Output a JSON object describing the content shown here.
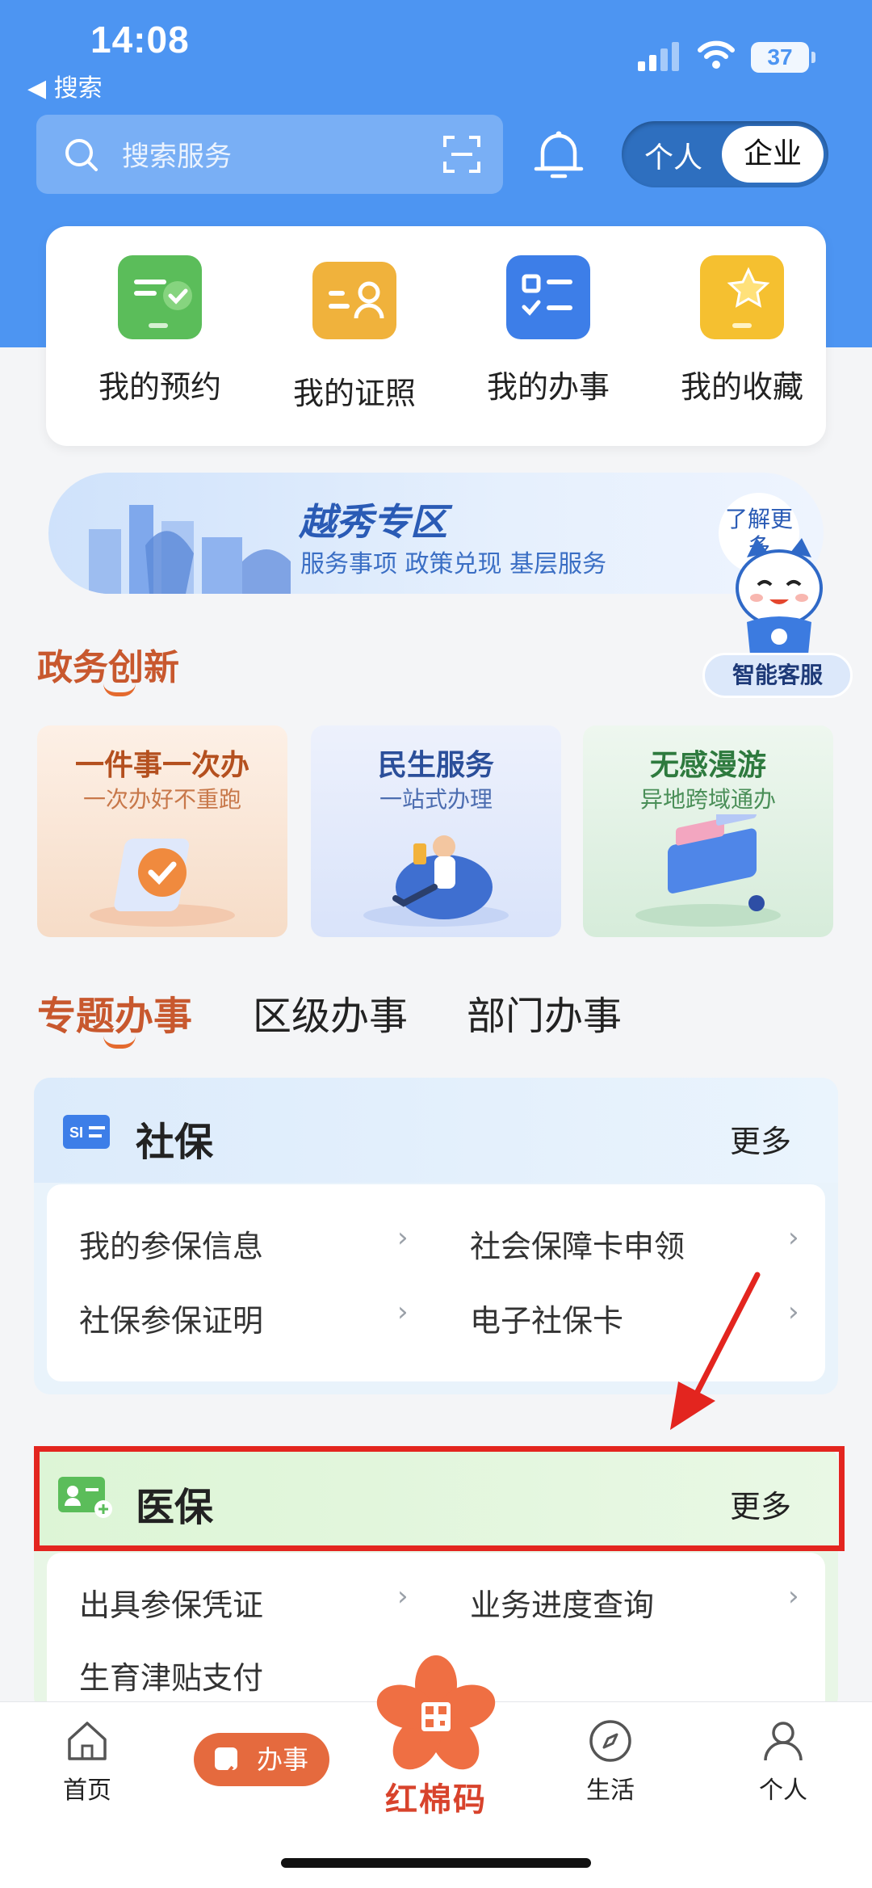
{
  "status_bar": {
    "time": "14:08",
    "back_label": "◀ 搜索",
    "battery": "37"
  },
  "header": {
    "search_placeholder": "搜索服务",
    "toggle": {
      "personal": "个人",
      "company": "企业",
      "selected": "企业"
    }
  },
  "quick_actions": [
    {
      "label": "我的预约",
      "icon": "appointment-icon",
      "color": "#5bbd5a"
    },
    {
      "label": "我的证照",
      "icon": "license-icon",
      "color": "#f0b23c"
    },
    {
      "label": "我的办事",
      "icon": "tasks-icon",
      "color": "#3d7ee8"
    },
    {
      "label": "我的收藏",
      "icon": "favorites-icon",
      "color": "#f5c030"
    }
  ],
  "banner": {
    "title": "越秀专区",
    "subtitle": "服务事项  政策兑现  基层服务",
    "more": "了解更多"
  },
  "assistant": {
    "label": "智能客服"
  },
  "innovation": {
    "title": "政务创新",
    "cards": [
      {
        "title": "一件事一次办",
        "subtitle": "一次办好不重跑",
        "bg": "#fbe9dd",
        "title_color": "#b4501f",
        "sub_color": "#c8784a"
      },
      {
        "title": "民生服务",
        "subtitle": "一站式办理",
        "bg": "#e4ebfb",
        "title_color": "#2b4f9a",
        "sub_color": "#4c6db0"
      },
      {
        "title": "无感漫游",
        "subtitle": "异地跨域通办",
        "bg": "#e3f1e6",
        "title_color": "#2e7a3e",
        "sub_color": "#4a8f58"
      }
    ]
  },
  "tabs": {
    "items": [
      "专题办事",
      "区级办事",
      "部门办事"
    ],
    "active": "专题办事"
  },
  "shebao": {
    "title": "社保",
    "more": "更多",
    "items": [
      "我的参保信息",
      "社会保障卡申领",
      "社保参保证明",
      "电子社保卡"
    ]
  },
  "yibao": {
    "title": "医保",
    "more": "更多",
    "items": [
      "出具参保凭证",
      "业务进度查询",
      "生育津贴支付"
    ]
  },
  "bottom_nav": {
    "home": "首页",
    "banshi": "办事",
    "center": "红棉码",
    "life": "生活",
    "personal": "个人"
  },
  "colors": {
    "header_blue": "#4d95f2",
    "accent_orange": "#e56a3e",
    "highlight_red": "#e3251f"
  }
}
